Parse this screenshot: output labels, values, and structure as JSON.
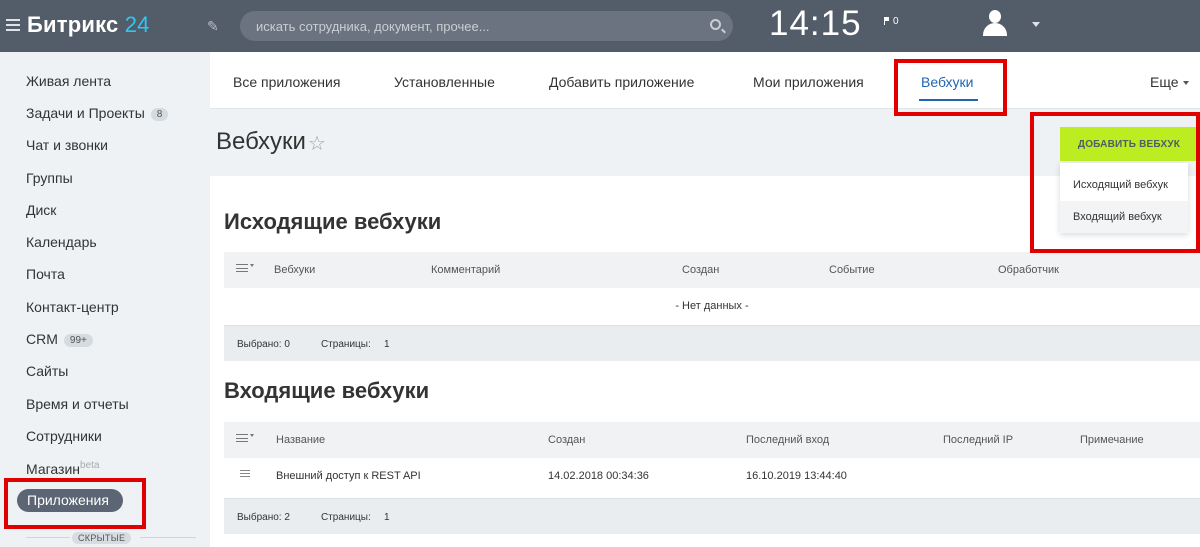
{
  "topbar": {
    "logo_text": "Битрикс",
    "logo_num": "24",
    "search_placeholder": "искать сотрудника, документ, прочее...",
    "clock": "14:15",
    "notifications": "0"
  },
  "sidebar": {
    "items": [
      {
        "label": "Живая лента"
      },
      {
        "label": "Задачи и Проекты",
        "badge": "8"
      },
      {
        "label": "Чат и звонки"
      },
      {
        "label": "Группы"
      },
      {
        "label": "Диск"
      },
      {
        "label": "Календарь"
      },
      {
        "label": "Почта"
      },
      {
        "label": "Контакт-центр"
      },
      {
        "label": "CRM",
        "badge": "99+"
      },
      {
        "label": "Сайты"
      },
      {
        "label": "Время и отчеты"
      },
      {
        "label": "Сотрудники"
      },
      {
        "label": "Магазин",
        "sup": "beta"
      }
    ],
    "active_item": "Приложения",
    "hidden_label": "СКРЫТЫЕ"
  },
  "tabs": {
    "items": [
      "Все приложения",
      "Установленные",
      "Добавить приложение",
      "Мои приложения",
      "Вебхуки"
    ],
    "more": "Еще",
    "active": "Вебхуки"
  },
  "page": {
    "title": "Вебхуки",
    "add_button": "ДОБАВИТЬ ВЕБХУК",
    "dropdown": [
      "Исходящий вебхук",
      "Входящий вебхук"
    ]
  },
  "outgoing": {
    "title": "Исходящие вебхуки",
    "columns": [
      "Вебхуки",
      "Комментарий",
      "Создан",
      "Событие",
      "Обработчик"
    ],
    "empty": "- Нет данных -",
    "footer_selected": "Выбрано: 0",
    "footer_pages_label": "Страницы:",
    "footer_pages": "1"
  },
  "incoming": {
    "title": "Входящие вебхуки",
    "columns": [
      "Название",
      "Создан",
      "Последний вход",
      "Последний IP",
      "Примечание"
    ],
    "rows": [
      {
        "name": "Внешний доступ к REST API",
        "created": "14.02.2018 00:34:36",
        "last_login": "16.10.2019 13:44:40",
        "last_ip": "",
        "note": ""
      }
    ],
    "footer_selected": "Выбрано: 2",
    "footer_pages_label": "Страницы:",
    "footer_pages": "1"
  }
}
